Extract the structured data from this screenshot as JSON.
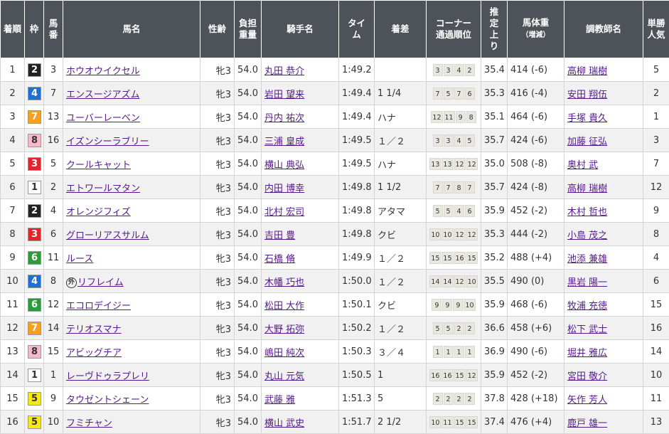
{
  "headers": {
    "rank": [
      "着順"
    ],
    "waku": [
      "枠"
    ],
    "umaban": [
      "馬",
      "番"
    ],
    "horse": [
      "馬名"
    ],
    "sexage": [
      "性齢"
    ],
    "weight": [
      "負担",
      "重量"
    ],
    "jockey": [
      "騎手名"
    ],
    "time": [
      "タイ",
      "ム"
    ],
    "margin": [
      "着差"
    ],
    "corner": [
      "コーナー",
      "通過順位"
    ],
    "last3f": [
      "推",
      "定",
      "上",
      "り"
    ],
    "bodyweight": [
      "馬体重",
      "（増減）"
    ],
    "trainer": [
      "調教師名"
    ],
    "popularity": [
      "単勝",
      "人気"
    ]
  },
  "waku_colors": {
    "1": {
      "bg": "#ffffff",
      "fg": "#333333"
    },
    "2": {
      "bg": "#222222",
      "fg": "#ffffff"
    },
    "3": {
      "bg": "#e0262c",
      "fg": "#ffffff"
    },
    "4": {
      "bg": "#1f6ed6",
      "fg": "#ffffff"
    },
    "5": {
      "bg": "#f5e61e",
      "fg": "#333333"
    },
    "6": {
      "bg": "#2f9a3c",
      "fg": "#ffffff"
    },
    "7": {
      "bg": "#f5a020",
      "fg": "#ffffff"
    },
    "8": {
      "bg": "#f7b8cc",
      "fg": "#333333"
    }
  },
  "rows": [
    {
      "rank": "1",
      "waku": "2",
      "umaban": "3",
      "horse": "ホウオウイクセル",
      "foreign_mark": "",
      "sexage": "牝3",
      "weight": "54.0",
      "jockey": "丸田 恭介",
      "time": "1:49.2",
      "margin": "",
      "corners": [
        "3",
        "3",
        "4",
        "2"
      ],
      "last3f": "35.4",
      "bodyweight": "414 (-6)",
      "trainer": "高柳 瑞樹",
      "popularity": "5"
    },
    {
      "rank": "2",
      "waku": "4",
      "umaban": "7",
      "horse": "エンスージアズム",
      "foreign_mark": "",
      "sexage": "牝3",
      "weight": "54.0",
      "jockey": "岩田 望来",
      "time": "1:49.4",
      "margin": "1 1/4",
      "corners": [
        "7",
        "5",
        "7",
        "6"
      ],
      "last3f": "35.3",
      "bodyweight": "416 (-4)",
      "trainer": "安田 翔伍",
      "popularity": "2"
    },
    {
      "rank": "3",
      "waku": "7",
      "umaban": "13",
      "horse": "ユーバーレーベン",
      "foreign_mark": "",
      "sexage": "牝3",
      "weight": "54.0",
      "jockey": "丹内 祐次",
      "time": "1:49.4",
      "margin": "ハナ",
      "corners": [
        "12",
        "11",
        "9",
        "8"
      ],
      "last3f": "35.1",
      "bodyweight": "464 (-6)",
      "trainer": "手塚 貴久",
      "popularity": "1"
    },
    {
      "rank": "4",
      "waku": "8",
      "umaban": "16",
      "horse": "イズンシーラブリー",
      "foreign_mark": "",
      "sexage": "牝3",
      "weight": "54.0",
      "jockey": "三浦 皇成",
      "time": "1:49.5",
      "margin": "１／２",
      "corners": [
        "3",
        "3",
        "4",
        "5"
      ],
      "last3f": "35.7",
      "bodyweight": "424 (-6)",
      "trainer": "加藤 征弘",
      "popularity": "3"
    },
    {
      "rank": "5",
      "waku": "3",
      "umaban": "5",
      "horse": "クールキャット",
      "foreign_mark": "",
      "sexage": "牝3",
      "weight": "54.0",
      "jockey": "横山 典弘",
      "time": "1:49.5",
      "margin": "ハナ",
      "corners": [
        "13",
        "13",
        "12",
        "12"
      ],
      "last3f": "35.0",
      "bodyweight": "508 (-8)",
      "trainer": "奥村 武",
      "popularity": "7"
    },
    {
      "rank": "6",
      "waku": "1",
      "umaban": "2",
      "horse": "エトワールマタン",
      "foreign_mark": "",
      "sexage": "牝3",
      "weight": "54.0",
      "jockey": "内田 博幸",
      "time": "1:49.8",
      "margin": "1 1/2",
      "corners": [
        "7",
        "7",
        "8",
        "7"
      ],
      "last3f": "35.7",
      "bodyweight": "424 (-8)",
      "trainer": "高柳 瑞樹",
      "popularity": "12"
    },
    {
      "rank": "7",
      "waku": "2",
      "umaban": "4",
      "horse": "オレンジフィズ",
      "foreign_mark": "",
      "sexage": "牝3",
      "weight": "54.0",
      "jockey": "北村 宏司",
      "time": "1:49.8",
      "margin": "アタマ",
      "corners": [
        "5",
        "5",
        "4",
        "6"
      ],
      "last3f": "35.9",
      "bodyweight": "452 (-2)",
      "trainer": "木村 哲也",
      "popularity": "9"
    },
    {
      "rank": "8",
      "waku": "3",
      "umaban": "6",
      "horse": "グローリアスサルム",
      "foreign_mark": "",
      "sexage": "牝3",
      "weight": "54.0",
      "jockey": "吉田 豊",
      "time": "1:49.8",
      "margin": "クビ",
      "corners": [
        "10",
        "10",
        "12",
        "12"
      ],
      "last3f": "35.3",
      "bodyweight": "444 (-2)",
      "trainer": "小島 茂之",
      "popularity": "8"
    },
    {
      "rank": "9",
      "waku": "6",
      "umaban": "11",
      "horse": "ルース",
      "foreign_mark": "",
      "sexage": "牝3",
      "weight": "54.0",
      "jockey": "石橋 脩",
      "time": "1:49.9",
      "margin": "１／２",
      "corners": [
        "15",
        "15",
        "16",
        "15"
      ],
      "last3f": "35.2",
      "bodyweight": "488 (+4)",
      "trainer": "池添 兼雄",
      "popularity": "4"
    },
    {
      "rank": "10",
      "waku": "4",
      "umaban": "8",
      "horse": "リフレイム",
      "foreign_mark": "外",
      "sexage": "牝3",
      "weight": "54.0",
      "jockey": "木幡 巧也",
      "time": "1:50.0",
      "margin": "１／２",
      "corners": [
        "14",
        "14",
        "12",
        "10"
      ],
      "last3f": "35.5",
      "bodyweight": "490 (0)",
      "trainer": "黒岩 陽一",
      "popularity": "6"
    },
    {
      "rank": "11",
      "waku": "6",
      "umaban": "12",
      "horse": "エコロデイジー",
      "foreign_mark": "",
      "sexage": "牝3",
      "weight": "54.0",
      "jockey": "松田 大作",
      "time": "1:50.1",
      "margin": "クビ",
      "corners": [
        "9",
        "9",
        "9",
        "10"
      ],
      "last3f": "35.9",
      "bodyweight": "468 (-6)",
      "trainer": "牧浦 充徳",
      "popularity": "15"
    },
    {
      "rank": "12",
      "waku": "7",
      "umaban": "14",
      "horse": "テリオスマナ",
      "foreign_mark": "",
      "sexage": "牝3",
      "weight": "54.0",
      "jockey": "大野 拓弥",
      "time": "1:50.2",
      "margin": "１／２",
      "corners": [
        "5",
        "5",
        "2",
        "2"
      ],
      "last3f": "36.6",
      "bodyweight": "458 (+6)",
      "trainer": "松下 武士",
      "popularity": "16"
    },
    {
      "rank": "13",
      "waku": "8",
      "umaban": "15",
      "horse": "アビッグチア",
      "foreign_mark": "",
      "sexage": "牝3",
      "weight": "54.0",
      "jockey": "嶋田 純次",
      "time": "1:50.3",
      "margin": "３／４",
      "corners": [
        "1",
        "1",
        "1",
        "1"
      ],
      "last3f": "36.9",
      "bodyweight": "490 (-6)",
      "trainer": "堀井 雅広",
      "popularity": "14"
    },
    {
      "rank": "14",
      "waku": "1",
      "umaban": "1",
      "horse": "レーヴドゥラプレリ",
      "foreign_mark": "",
      "sexage": "牝3",
      "weight": "54.0",
      "jockey": "丸山 元気",
      "time": "1:50.5",
      "margin": "1",
      "corners": [
        "16",
        "16",
        "15",
        "12"
      ],
      "last3f": "35.9",
      "bodyweight": "452 (-2)",
      "trainer": "宮田 敬介",
      "popularity": "10"
    },
    {
      "rank": "15",
      "waku": "5",
      "umaban": "9",
      "horse": "タウゼントシェーン",
      "foreign_mark": "",
      "sexage": "牝3",
      "weight": "54.0",
      "jockey": "武藤 雅",
      "time": "1:51.3",
      "margin": "5",
      "corners": [
        "2",
        "2",
        "2",
        "2"
      ],
      "last3f": "37.8",
      "bodyweight": "428 (+18)",
      "trainer": "矢作 芳人",
      "popularity": "11"
    },
    {
      "rank": "16",
      "waku": "5",
      "umaban": "10",
      "horse": "フミチャン",
      "foreign_mark": "",
      "sexage": "牝3",
      "weight": "54.0",
      "jockey": "横山 武史",
      "time": "1:51.7",
      "margin": "2 1/2",
      "corners": [
        "10",
        "11",
        "15",
        "15"
      ],
      "last3f": "37.4",
      "bodyweight": "476 (+4)",
      "trainer": "鹿戸 雄一",
      "popularity": "13"
    }
  ]
}
